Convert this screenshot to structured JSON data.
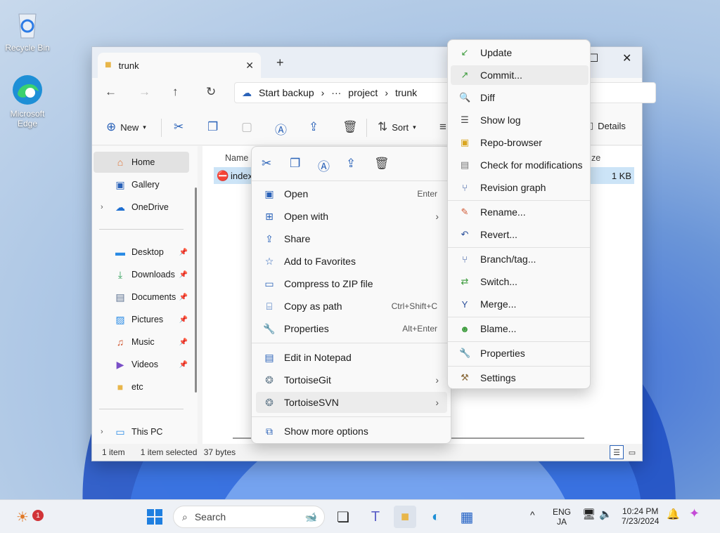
{
  "desktop": {
    "icons": [
      {
        "label": "Recycle Bin",
        "icon": "recycle-bin-icon"
      },
      {
        "label": "Microsoft Edge",
        "icon": "edge-icon"
      }
    ]
  },
  "explorer": {
    "tab_title": "trunk",
    "tab_close": "✕",
    "new_tab": "+",
    "window_controls": {
      "maximize": "☐",
      "close": "✕"
    },
    "nav": {
      "back": "←",
      "forward": "→",
      "up": "↑",
      "refresh": "↻"
    },
    "breadcrumb": {
      "backup": "Start backup",
      "sep": "›",
      "ellipsis": "···",
      "project": "project",
      "trunk": "trunk"
    },
    "toolbar": {
      "new": "New",
      "sort": "Sort",
      "details": "Details"
    },
    "sidebar": {
      "home": "Home",
      "gallery": "Gallery",
      "onedrive": "OneDrive",
      "desktop": "Desktop",
      "downloads": "Downloads",
      "documents": "Documents",
      "pictures": "Pictures",
      "music": "Music",
      "videos": "Videos",
      "etc": "etc",
      "thispc": "This PC"
    },
    "columns": {
      "name": "Name",
      "size": "ze"
    },
    "file": {
      "name": "index",
      "size": "1 KB"
    },
    "status": {
      "count": "1 item",
      "selected": "1 item selected",
      "bytes": "37 bytes"
    }
  },
  "context_menu": {
    "items": {
      "open": {
        "label": "Open",
        "shortcut": "Enter"
      },
      "open_with": {
        "label": "Open with"
      },
      "share": {
        "label": "Share"
      },
      "favorites": {
        "label": "Add to Favorites"
      },
      "zip": {
        "label": "Compress to ZIP file"
      },
      "copy_path": {
        "label": "Copy as path",
        "shortcut": "Ctrl+Shift+C"
      },
      "properties": {
        "label": "Properties",
        "shortcut": "Alt+Enter"
      },
      "notepad": {
        "label": "Edit in Notepad"
      },
      "tortoisegit": {
        "label": "TortoiseGit"
      },
      "tortoisesvn": {
        "label": "TortoiseSVN"
      },
      "more": {
        "label": "Show more options"
      }
    },
    "arrow": "›"
  },
  "svn_menu": {
    "update": "Update",
    "commit": "Commit...",
    "diff": "Diff",
    "showlog": "Show log",
    "repobrowser": "Repo-browser",
    "checkmods": "Check for modifications",
    "revgraph": "Revision graph",
    "rename": "Rename...",
    "revert": "Revert...",
    "branch": "Branch/tag...",
    "switch": "Switch...",
    "merge": "Merge...",
    "blame": "Blame...",
    "properties": "Properties",
    "settings": "Settings"
  },
  "taskbar": {
    "search_placeholder": "Search",
    "badge": "1",
    "lang_top": "ENG",
    "lang_bottom": "JA",
    "time": "10:24 PM",
    "date": "7/23/2024"
  },
  "colors": {
    "accent": "#2a62b8",
    "selection": "#cce4f7"
  }
}
